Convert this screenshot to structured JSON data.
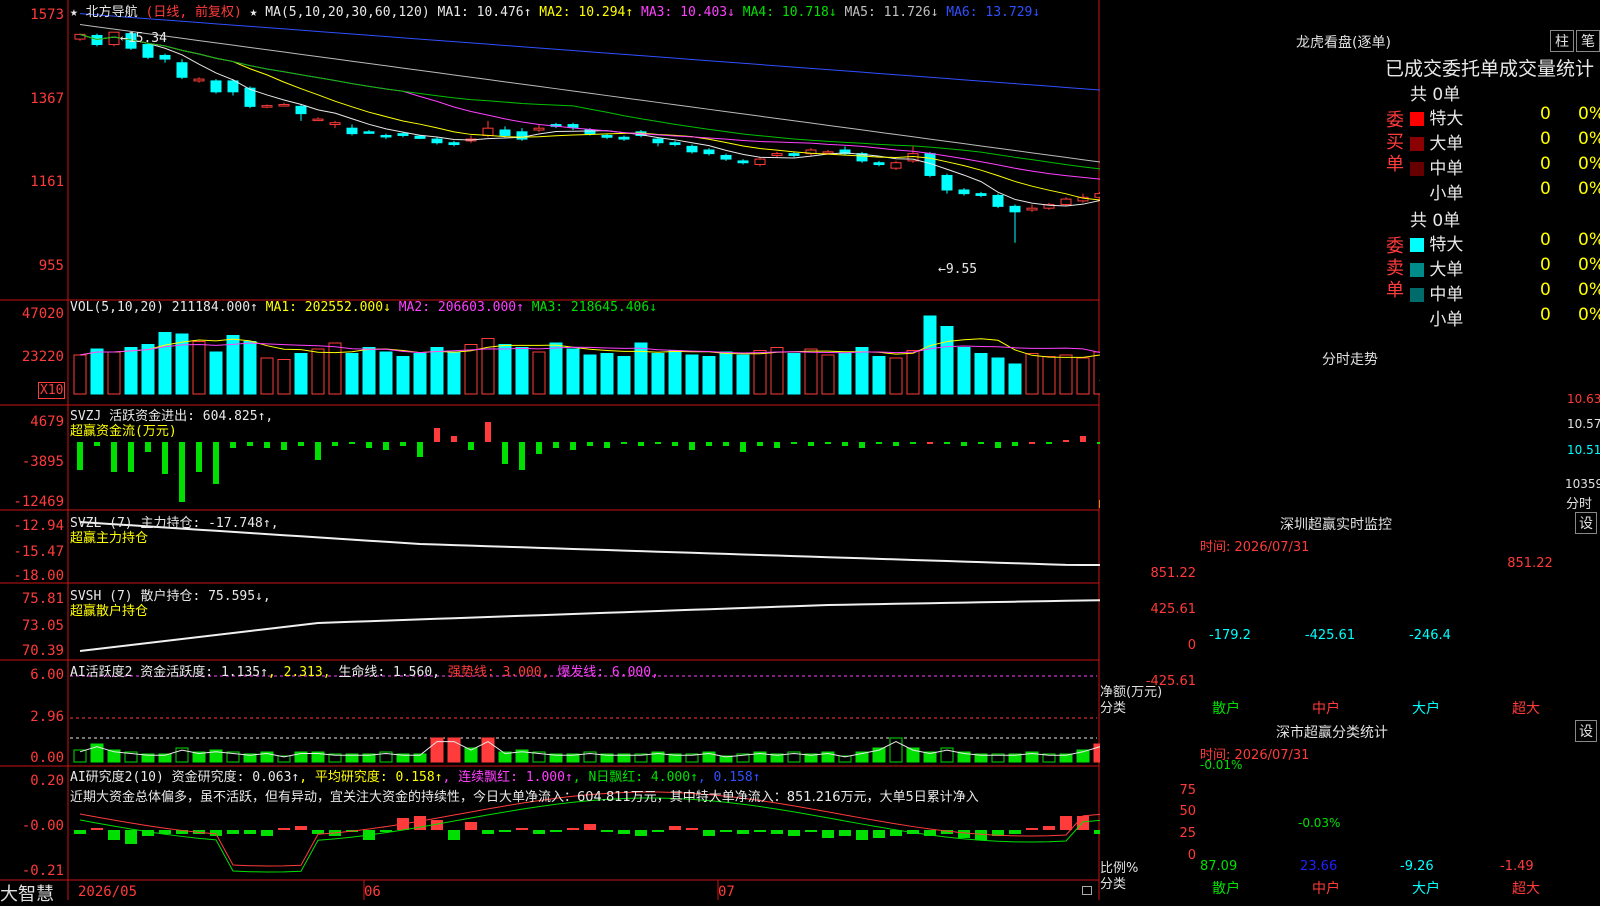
{
  "app": {
    "name": "大智慧"
  },
  "main_chart": {
    "star": "★",
    "stock_name": "北方导航",
    "period": "(日线, 前复权)",
    "ma_params": "MA(5,10,20,30,60,120)",
    "ma1": "MA1: 10.476↑",
    "ma2": "MA2: 10.294↑",
    "ma3": "MA3: 10.403↓",
    "ma4": "MA4: 10.718↓",
    "ma5": "MA5: 11.726↓",
    "ma6": "MA6: 13.729↓",
    "y_ticks": [
      "1573",
      "1367",
      "1161",
      "955"
    ],
    "high_mark": "←15.34",
    "low_mark": "←9.55"
  },
  "volume_panel": {
    "params": "VOL(5,10,20)",
    "value": "211184.000↑",
    "ma1": "MA1: 202552.000↓",
    "ma2": "MA2: 206603.000↑",
    "ma3": "MA3: 218645.406↓",
    "y_ticks": [
      "47020",
      "23220"
    ],
    "unit": "X10"
  },
  "svzj_panel": {
    "line1": "SVZJ  活跃资金进出: 604.825↑,",
    "line2": "超赢资金流(万元)",
    "y_ticks": [
      "4679",
      "-3895",
      "-12469"
    ]
  },
  "svzl_panel": {
    "line1": "SVZL (7) 主力持仓: -17.748↑,",
    "line2": "超赢主力持仓",
    "y_ticks": [
      "-12.94",
      "-15.47",
      "-18.00"
    ]
  },
  "svsh_panel": {
    "line1": "SVSH (7) 散户持仓: 75.595↓,",
    "line2": "超赢散户持仓",
    "y_ticks": [
      "75.81",
      "73.05",
      "70.39"
    ]
  },
  "ai_active_panel": {
    "label": "AI活跃度2 资金活跃度: 1.135↑",
    "v2": ", 2.313,",
    "life": " 生命线: 1.560,",
    "strong": " 强势线: 3.000,",
    "burst": " 爆发线: 6.000,",
    "y_ticks": [
      "6.00",
      "2.96",
      "0.00"
    ]
  },
  "ai_research_panel": {
    "label": "AI研究度2(10) 资金研究度: 0.063↑",
    "avg": ", 平均研究度: 0.158↑",
    "streak": ", 连续飘红: 1.000↑",
    "nday": ", N日飘红: 4.000↑",
    "last": ", 0.158↑",
    "comment": "近期大资金总体偏多，虽不活跃，但有异动，宜关注大资金的持续性，今日大单净流入：604.811万元，其中特大单净流入：851.216万元，大单5日累计净入",
    "y_ticks": [
      "0.20",
      "-0.00",
      "-0.21"
    ]
  },
  "x_axis": {
    "labels": [
      "2026/05",
      "06",
      "07"
    ]
  },
  "right": {
    "lhb_title": "龙虎看盘(逐单)",
    "btn_zhu": "柱",
    "btn_bi": "笔",
    "table_header": "已成交委托单成交量统计",
    "buy_side_label": "委买单",
    "sell_side_label": "委卖单",
    "buy_total": "共 0单",
    "sell_total": "共 0单",
    "rows_buy": [
      {
        "label": "特大",
        "count": "0",
        "pct": "0%",
        "color": "#ff0000"
      },
      {
        "label": "大单",
        "count": "0",
        "pct": "0%",
        "color": "#8b0000"
      },
      {
        "label": "中单",
        "count": "0",
        "pct": "0%",
        "color": "#660000"
      },
      {
        "label": "小单",
        "count": "0",
        "pct": "0%",
        "color": "#000000"
      }
    ],
    "rows_sell": [
      {
        "label": "特大",
        "count": "0",
        "pct": "0%",
        "color": "#00ffff"
      },
      {
        "label": "大单",
        "count": "0",
        "pct": "0%",
        "color": "#008b8b"
      },
      {
        "label": "中单",
        "count": "0",
        "pct": "0%",
        "color": "#006b6b"
      },
      {
        "label": "小单",
        "count": "0",
        "pct": "0%",
        "color": "#000000"
      }
    ],
    "intraday_title": "分时走势",
    "intraday_prices": [
      "10.63",
      "10.57",
      "10.51"
    ],
    "intraday_vol": "10359",
    "intraday_vol_label": "分时",
    "sz_monitor_title": "深圳超赢实时监控",
    "sz_monitor_time": "时间: 2026/07/31",
    "settings_label": "设",
    "monitor_y_ticks": [
      "851.22",
      "425.61",
      "0",
      "-425.61"
    ],
    "monitor_values": [
      "-179.2",
      "-425.61",
      "-246.4",
      "851.22"
    ],
    "monitor_categories": [
      "散户",
      "中户",
      "大户",
      "超大"
    ],
    "monitor_axis_label_1": "净额(万元)",
    "monitor_axis_label_2": "分类",
    "sz_class_title": "深市超赢分类统计",
    "sz_class_time": "时间: 2026/07/31",
    "class_y_ticks": [
      "75",
      "50",
      "25",
      "0"
    ],
    "class_top_values": [
      "-0.01%",
      "-0.03%"
    ],
    "class_values": [
      "87.09",
      "23.66",
      "-9.26",
      "-1.49"
    ],
    "class_categories": [
      "散户",
      "中户",
      "大户",
      "超大"
    ],
    "class_axis_label_1": "比例%",
    "class_axis_label_2": "分类"
  },
  "chart_data": {
    "type": "candlestick",
    "title": "北方导航 (日线, 前复权)",
    "candles": [
      [
        15.15,
        15.28,
        15.3,
        15.1
      ],
      [
        15.25,
        15.0,
        15.3,
        14.95
      ],
      [
        15.0,
        15.34,
        15.34,
        14.95
      ],
      [
        15.3,
        14.9,
        15.32,
        14.85
      ],
      [
        15.0,
        14.65,
        15.05,
        14.6
      ],
      [
        14.7,
        14.6,
        14.75,
        14.5
      ],
      [
        14.5,
        14.1,
        14.6,
        14.05
      ],
      [
        14.0,
        14.05,
        14.1,
        13.95
      ],
      [
        14.0,
        13.7,
        14.05,
        13.65
      ],
      [
        14.0,
        13.7,
        14.05,
        13.6
      ],
      [
        13.8,
        13.3,
        13.85,
        13.25
      ],
      [
        13.3,
        13.32,
        13.35,
        13.25
      ],
      [
        13.35,
        13.35,
        13.4,
        13.3
      ],
      [
        13.3,
        13.1,
        13.35,
        12.9
      ],
      [
        12.95,
        12.95,
        13.0,
        12.9
      ],
      [
        12.8,
        12.85,
        12.9,
        12.7
      ],
      [
        12.7,
        12.55,
        12.8,
        12.5
      ],
      [
        12.6,
        12.58,
        12.65,
        12.55
      ],
      [
        12.5,
        12.48,
        12.55,
        12.4
      ],
      [
        12.55,
        12.5,
        12.6,
        12.45
      ],
      [
        12.48,
        12.42,
        12.5,
        12.4
      ],
      [
        12.4,
        12.3,
        12.45,
        12.25
      ],
      [
        12.3,
        12.25,
        12.35,
        12.2
      ],
      [
        12.35,
        12.4,
        12.5,
        12.3
      ],
      [
        12.5,
        12.7,
        12.9,
        12.45
      ],
      [
        12.65,
        12.5,
        12.75,
        12.45
      ],
      [
        12.6,
        12.4,
        12.7,
        12.35
      ],
      [
        12.65,
        12.7,
        12.8,
        12.6
      ],
      [
        12.8,
        12.75,
        12.85,
        12.7
      ],
      [
        12.8,
        12.72,
        12.85,
        12.65
      ],
      [
        12.65,
        12.55,
        12.7,
        12.5
      ],
      [
        12.5,
        12.45,
        12.55,
        12.4
      ],
      [
        12.45,
        12.4,
        12.5,
        12.35
      ],
      [
        12.6,
        12.5,
        12.65,
        12.45
      ],
      [
        12.4,
        12.3,
        12.45,
        12.2
      ],
      [
        12.3,
        12.25,
        12.35,
        12.2
      ],
      [
        12.2,
        12.05,
        12.25,
        12.0
      ],
      [
        12.1,
        12.0,
        12.15,
        11.95
      ],
      [
        11.95,
        11.85,
        12.0,
        11.8
      ],
      [
        11.8,
        11.75,
        11.85,
        11.7
      ],
      [
        11.7,
        11.85,
        11.9,
        11.65
      ],
      [
        11.95,
        12.0,
        12.05,
        11.9
      ],
      [
        12.0,
        11.95,
        12.05,
        11.9
      ],
      [
        12.0,
        12.1,
        12.15,
        11.95
      ],
      [
        12.05,
        12.05,
        12.1,
        12.0
      ],
      [
        12.1,
        12.0,
        12.2,
        11.95
      ],
      [
        12.0,
        11.8,
        12.05,
        11.75
      ],
      [
        11.75,
        11.7,
        11.8,
        11.65
      ],
      [
        11.6,
        11.75,
        11.8,
        11.55
      ],
      [
        11.8,
        12.0,
        12.2,
        11.75
      ],
      [
        12.0,
        11.4,
        12.05,
        11.35
      ],
      [
        11.4,
        11.0,
        11.45,
        10.9
      ],
      [
        11.0,
        10.9,
        11.05,
        10.85
      ],
      [
        10.9,
        10.85,
        10.95,
        10.8
      ],
      [
        10.85,
        10.55,
        10.9,
        10.5
      ],
      [
        10.55,
        10.4,
        10.6,
        9.55
      ],
      [
        10.45,
        10.5,
        10.6,
        10.4
      ],
      [
        10.5,
        10.6,
        10.65,
        10.45
      ],
      [
        10.6,
        10.75,
        10.8,
        10.55
      ],
      [
        10.7,
        10.8,
        10.9,
        10.65
      ],
      [
        10.8,
        10.9,
        10.95,
        10.75
      ],
      [
        10.9,
        10.85,
        10.95,
        10.8
      ],
      [
        10.85,
        10.95,
        11.0,
        10.8
      ],
      [
        10.95,
        11.0,
        11.05,
        10.9
      ],
      [
        11.0,
        10.98,
        11.05,
        10.9
      ]
    ]
  }
}
